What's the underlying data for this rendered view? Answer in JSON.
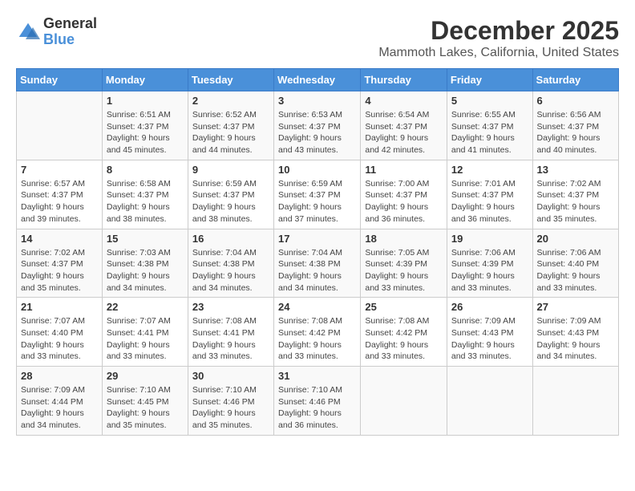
{
  "header": {
    "logo_general": "General",
    "logo_blue": "Blue",
    "main_title": "December 2025",
    "subtitle": "Mammoth Lakes, California, United States"
  },
  "weekdays": [
    "Sunday",
    "Monday",
    "Tuesday",
    "Wednesday",
    "Thursday",
    "Friday",
    "Saturday"
  ],
  "weeks": [
    [
      {
        "day": "",
        "info": ""
      },
      {
        "day": "1",
        "info": "Sunrise: 6:51 AM\nSunset: 4:37 PM\nDaylight: 9 hours and 45 minutes."
      },
      {
        "day": "2",
        "info": "Sunrise: 6:52 AM\nSunset: 4:37 PM\nDaylight: 9 hours and 44 minutes."
      },
      {
        "day": "3",
        "info": "Sunrise: 6:53 AM\nSunset: 4:37 PM\nDaylight: 9 hours and 43 minutes."
      },
      {
        "day": "4",
        "info": "Sunrise: 6:54 AM\nSunset: 4:37 PM\nDaylight: 9 hours and 42 minutes."
      },
      {
        "day": "5",
        "info": "Sunrise: 6:55 AM\nSunset: 4:37 PM\nDaylight: 9 hours and 41 minutes."
      },
      {
        "day": "6",
        "info": "Sunrise: 6:56 AM\nSunset: 4:37 PM\nDaylight: 9 hours and 40 minutes."
      }
    ],
    [
      {
        "day": "7",
        "info": "Sunrise: 6:57 AM\nSunset: 4:37 PM\nDaylight: 9 hours and 39 minutes."
      },
      {
        "day": "8",
        "info": "Sunrise: 6:58 AM\nSunset: 4:37 PM\nDaylight: 9 hours and 38 minutes."
      },
      {
        "day": "9",
        "info": "Sunrise: 6:59 AM\nSunset: 4:37 PM\nDaylight: 9 hours and 38 minutes."
      },
      {
        "day": "10",
        "info": "Sunrise: 6:59 AM\nSunset: 4:37 PM\nDaylight: 9 hours and 37 minutes."
      },
      {
        "day": "11",
        "info": "Sunrise: 7:00 AM\nSunset: 4:37 PM\nDaylight: 9 hours and 36 minutes."
      },
      {
        "day": "12",
        "info": "Sunrise: 7:01 AM\nSunset: 4:37 PM\nDaylight: 9 hours and 36 minutes."
      },
      {
        "day": "13",
        "info": "Sunrise: 7:02 AM\nSunset: 4:37 PM\nDaylight: 9 hours and 35 minutes."
      }
    ],
    [
      {
        "day": "14",
        "info": "Sunrise: 7:02 AM\nSunset: 4:37 PM\nDaylight: 9 hours and 35 minutes."
      },
      {
        "day": "15",
        "info": "Sunrise: 7:03 AM\nSunset: 4:38 PM\nDaylight: 9 hours and 34 minutes."
      },
      {
        "day": "16",
        "info": "Sunrise: 7:04 AM\nSunset: 4:38 PM\nDaylight: 9 hours and 34 minutes."
      },
      {
        "day": "17",
        "info": "Sunrise: 7:04 AM\nSunset: 4:38 PM\nDaylight: 9 hours and 34 minutes."
      },
      {
        "day": "18",
        "info": "Sunrise: 7:05 AM\nSunset: 4:39 PM\nDaylight: 9 hours and 33 minutes."
      },
      {
        "day": "19",
        "info": "Sunrise: 7:06 AM\nSunset: 4:39 PM\nDaylight: 9 hours and 33 minutes."
      },
      {
        "day": "20",
        "info": "Sunrise: 7:06 AM\nSunset: 4:40 PM\nDaylight: 9 hours and 33 minutes."
      }
    ],
    [
      {
        "day": "21",
        "info": "Sunrise: 7:07 AM\nSunset: 4:40 PM\nDaylight: 9 hours and 33 minutes."
      },
      {
        "day": "22",
        "info": "Sunrise: 7:07 AM\nSunset: 4:41 PM\nDaylight: 9 hours and 33 minutes."
      },
      {
        "day": "23",
        "info": "Sunrise: 7:08 AM\nSunset: 4:41 PM\nDaylight: 9 hours and 33 minutes."
      },
      {
        "day": "24",
        "info": "Sunrise: 7:08 AM\nSunset: 4:42 PM\nDaylight: 9 hours and 33 minutes."
      },
      {
        "day": "25",
        "info": "Sunrise: 7:08 AM\nSunset: 4:42 PM\nDaylight: 9 hours and 33 minutes."
      },
      {
        "day": "26",
        "info": "Sunrise: 7:09 AM\nSunset: 4:43 PM\nDaylight: 9 hours and 33 minutes."
      },
      {
        "day": "27",
        "info": "Sunrise: 7:09 AM\nSunset: 4:43 PM\nDaylight: 9 hours and 34 minutes."
      }
    ],
    [
      {
        "day": "28",
        "info": "Sunrise: 7:09 AM\nSunset: 4:44 PM\nDaylight: 9 hours and 34 minutes."
      },
      {
        "day": "29",
        "info": "Sunrise: 7:10 AM\nSunset: 4:45 PM\nDaylight: 9 hours and 35 minutes."
      },
      {
        "day": "30",
        "info": "Sunrise: 7:10 AM\nSunset: 4:46 PM\nDaylight: 9 hours and 35 minutes."
      },
      {
        "day": "31",
        "info": "Sunrise: 7:10 AM\nSunset: 4:46 PM\nDaylight: 9 hours and 36 minutes."
      },
      {
        "day": "",
        "info": ""
      },
      {
        "day": "",
        "info": ""
      },
      {
        "day": "",
        "info": ""
      }
    ]
  ]
}
